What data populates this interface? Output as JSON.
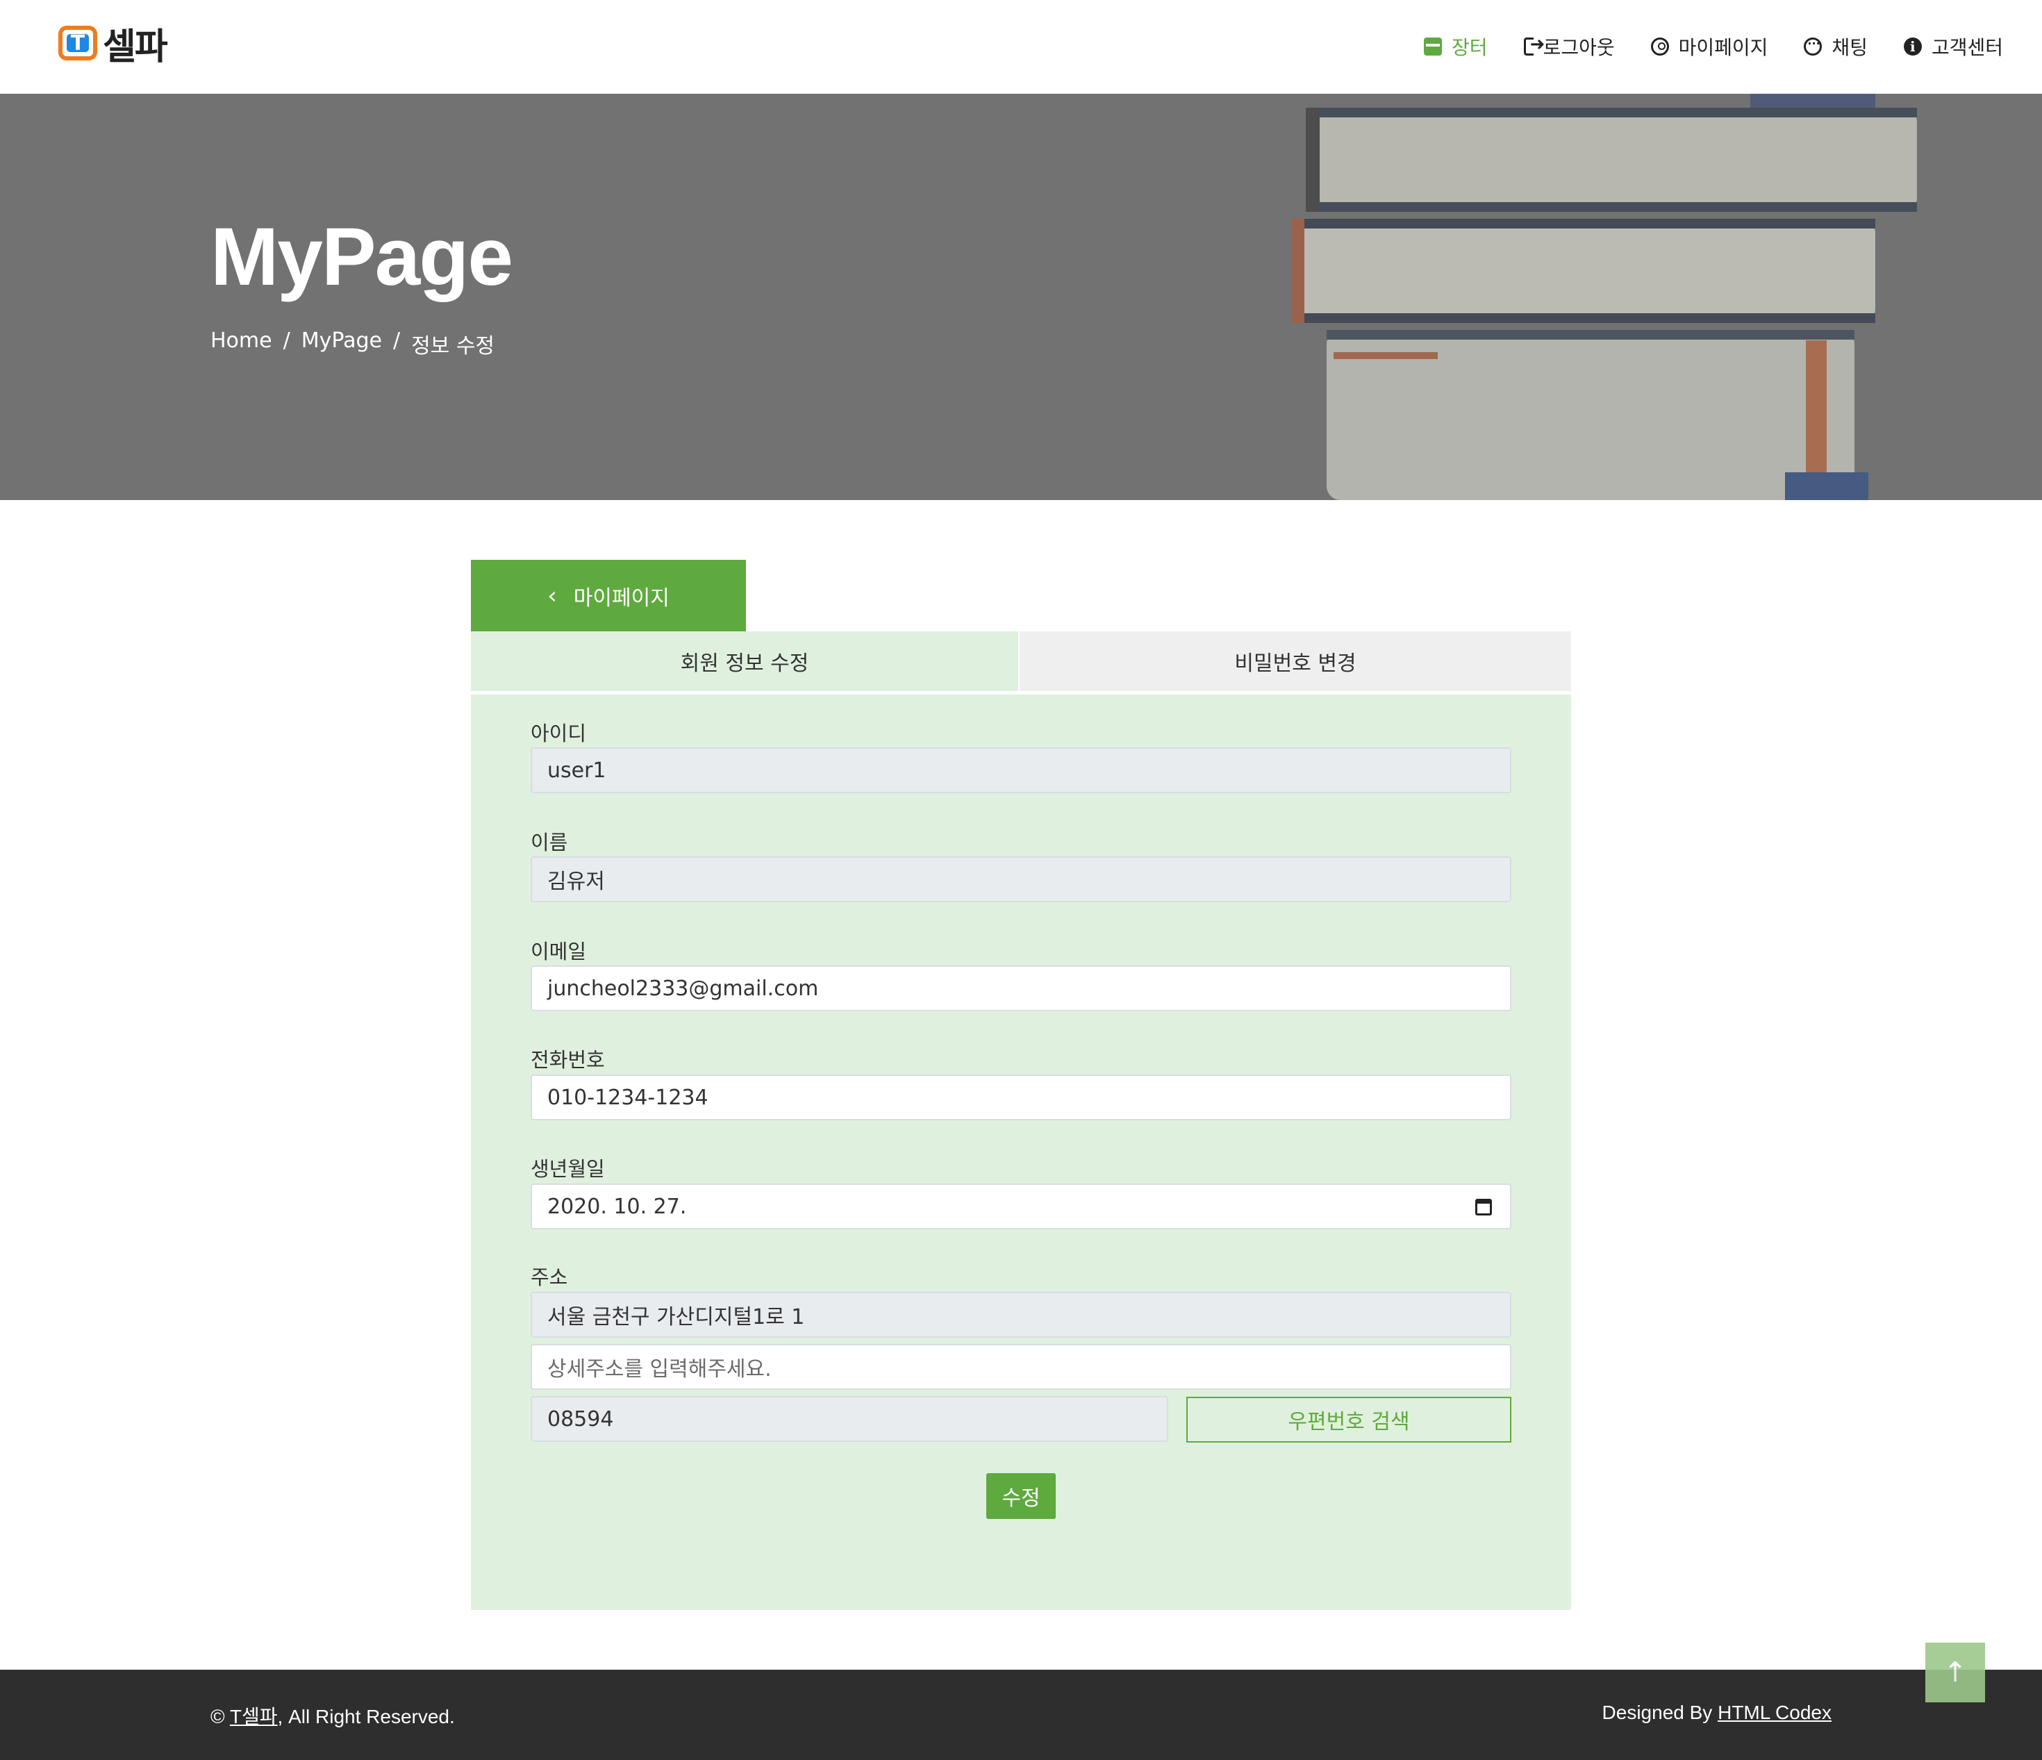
{
  "brand": {
    "mark": "T",
    "name": "셀파"
  },
  "nav": {
    "items": [
      {
        "label": "장터",
        "icon": "store-icon",
        "active": true
      },
      {
        "label": "로그아웃",
        "icon": "logout-icon",
        "active": false
      },
      {
        "label": "마이페이지",
        "icon": "user-circle-icon",
        "active": false
      },
      {
        "label": "채팅",
        "icon": "chat-icon",
        "active": false
      },
      {
        "label": "고객센터",
        "icon": "info-icon",
        "active": false
      }
    ]
  },
  "hero": {
    "title": "MyPage",
    "breadcrumb": [
      "Home",
      "MyPage",
      "정보 수정"
    ],
    "separator": "/"
  },
  "back_tab": {
    "label": "마이페이지",
    "icon": "chevron-left-icon"
  },
  "tabs": {
    "info": "회원 정보 수정",
    "password": "비밀번호 변경"
  },
  "form": {
    "id_label": "아이디",
    "id_value": "user1",
    "name_label": "이름",
    "name_value": "김유저",
    "email_label": "이메일",
    "email_value": "juncheol2333@gmail.com",
    "phone_label": "전화번호",
    "phone_value": "010-1234-1234",
    "birth_label": "생년월일",
    "birth_value": "2020. 10. 27.",
    "address_label": "주소",
    "address_value": "서울 금천구 가산디지털1로 1",
    "address_detail_placeholder": "상세주소를 입력해주세요.",
    "zipcode_value": "08594",
    "zip_search_label": "우편번호 검색",
    "submit_label": "수정"
  },
  "footer": {
    "copyright_prefix": "©",
    "brand_link": "T셀파",
    "copyright_suffix": ", All Right Reserved.",
    "designed_by": "Designed By",
    "designer_link": "HTML Codex"
  },
  "colors": {
    "accent": "#5faa3e",
    "hero_bg": "#727272",
    "form_bg": "#e0f0de",
    "footer_bg": "#2e2e2e"
  }
}
